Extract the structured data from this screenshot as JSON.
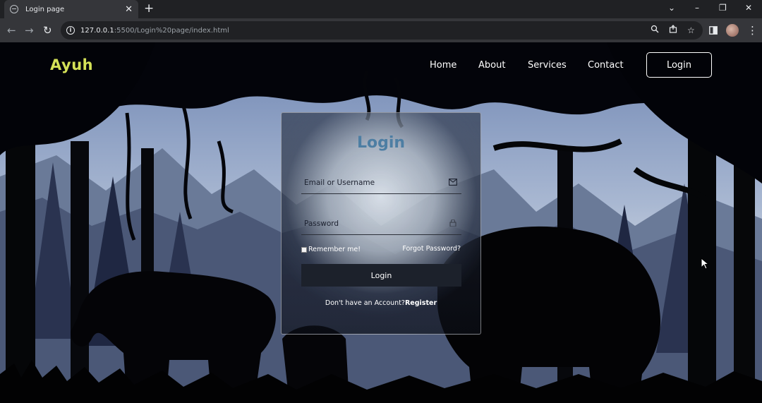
{
  "browser": {
    "tab_title": "Login page",
    "tab_close": "✕",
    "new_tab": "+",
    "url_host": "127.0.0.1",
    "url_path": ":5500/Login%20page/index.html",
    "window_controls": [
      "⌄",
      "–",
      "❐",
      "✕"
    ]
  },
  "site": {
    "logo": "Ayuh",
    "nav": [
      "Home",
      "About",
      "Services",
      "Contact"
    ],
    "nav_login": "Login"
  },
  "login_form": {
    "title": "Login",
    "email_placeholder": "Email or Username",
    "password_placeholder": "Password",
    "remember_label": "Remember me!",
    "forgot_link": "Forgot Password?",
    "submit_label": "Login",
    "no_account_text": "Don't have an Account?",
    "register_link": "Register"
  },
  "colors": {
    "logo": "#d4e157",
    "title": "#4d7ea3",
    "button": "#1c212b"
  },
  "icons": [
    "globe-icon",
    "back-arrow-icon",
    "forward-arrow-icon",
    "reload-icon",
    "info-icon",
    "zoom-icon",
    "share-icon",
    "star-icon",
    "sidebar-icon",
    "menu-dots-icon",
    "mail-icon",
    "lock-icon",
    "cursor-icon"
  ]
}
